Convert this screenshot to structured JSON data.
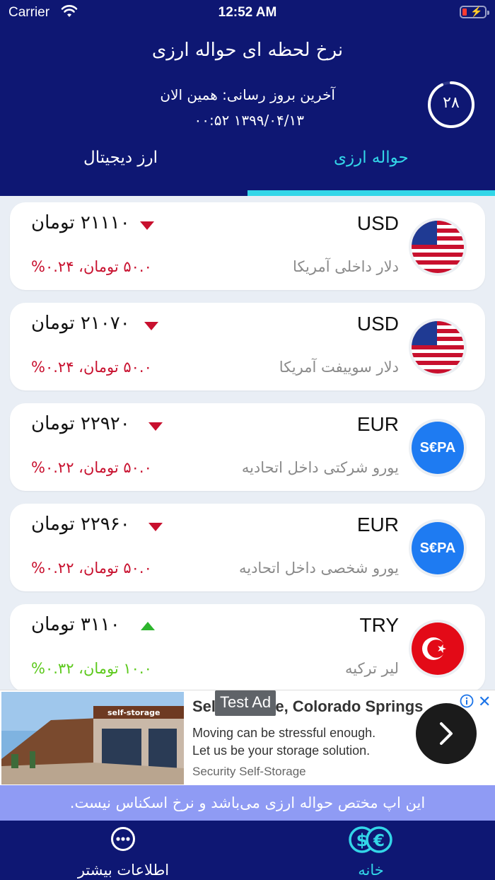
{
  "status_bar": {
    "carrier": "Carrier",
    "time": "12:52 AM"
  },
  "header": {
    "title": "نرخ لحظه ای حواله ارزی",
    "last_update_label": "آخرین بروز رسانی: همین الان",
    "last_update_time": "۱۳۹۹/۰۴/۱۳   ۰۰:۵۲",
    "countdown": "۲۸",
    "countdown_progress": 0.93
  },
  "tabs": [
    {
      "label": "حواله ارزی",
      "active": true
    },
    {
      "label": "ارز دیجیتال",
      "active": false
    }
  ],
  "rates": [
    {
      "code": "USD",
      "name": "دلار داخلی آمریکا",
      "price": "۲۱۱۱۰ تومان",
      "change": "۵۰.۰ تومان، ۰.۲۴%",
      "direction": "down",
      "flag": "us-flag"
    },
    {
      "code": "USD",
      "name": "دلار سوییفت آمریکا",
      "price": "۲۱۰۷۰ تومان",
      "change": "۵۰.۰ تومان، ۰.۲۴%",
      "direction": "down",
      "flag": "us-flag"
    },
    {
      "code": "EUR",
      "name": "یورو شرکتی داخل اتحادیه",
      "price": "۲۲۹۲۰ تومان",
      "change": "۵۰.۰ تومان، ۰.۲۲%",
      "direction": "down",
      "flag": "sepa-logo",
      "logo_text": "S€PA"
    },
    {
      "code": "EUR",
      "name": "یورو شخصی داخل اتحادیه",
      "price": "۲۲۹۶۰ تومان",
      "change": "۵۰.۰ تومان، ۰.۲۲%",
      "direction": "down",
      "flag": "sepa-logo",
      "logo_text": "S€PA"
    },
    {
      "code": "TRY",
      "name": "لیر ترکیه",
      "price": "۳۱۱۰ تومان",
      "change": "۱۰.۰ تومان، ۰.۳۲%",
      "direction": "up",
      "flag": "tr-flag"
    }
  ],
  "ad": {
    "badge": "Test Ad",
    "title": "Self-Storage, Colorado Springs",
    "line1": "Moving can be stressful enough.",
    "line2": "Let us be your storage solution.",
    "advertiser": "Security Self-Storage",
    "close": "✕",
    "image_sign": "self-storage"
  },
  "notice": "این اپ مختص حواله ارزی می‌باشد و نرخ اسکناس نیست.",
  "bottom_nav": [
    {
      "label": "خانه",
      "icon": "currency-exchange-icon",
      "active": true
    },
    {
      "label": "اطلاعات بیشتر",
      "icon": "more-icon",
      "active": false
    }
  ],
  "colors": {
    "header_bg": "#0e1773",
    "accent": "#33d6e8",
    "down": "#c8102e",
    "up": "#2db52d",
    "notice_bg": "#8f9bf4"
  }
}
